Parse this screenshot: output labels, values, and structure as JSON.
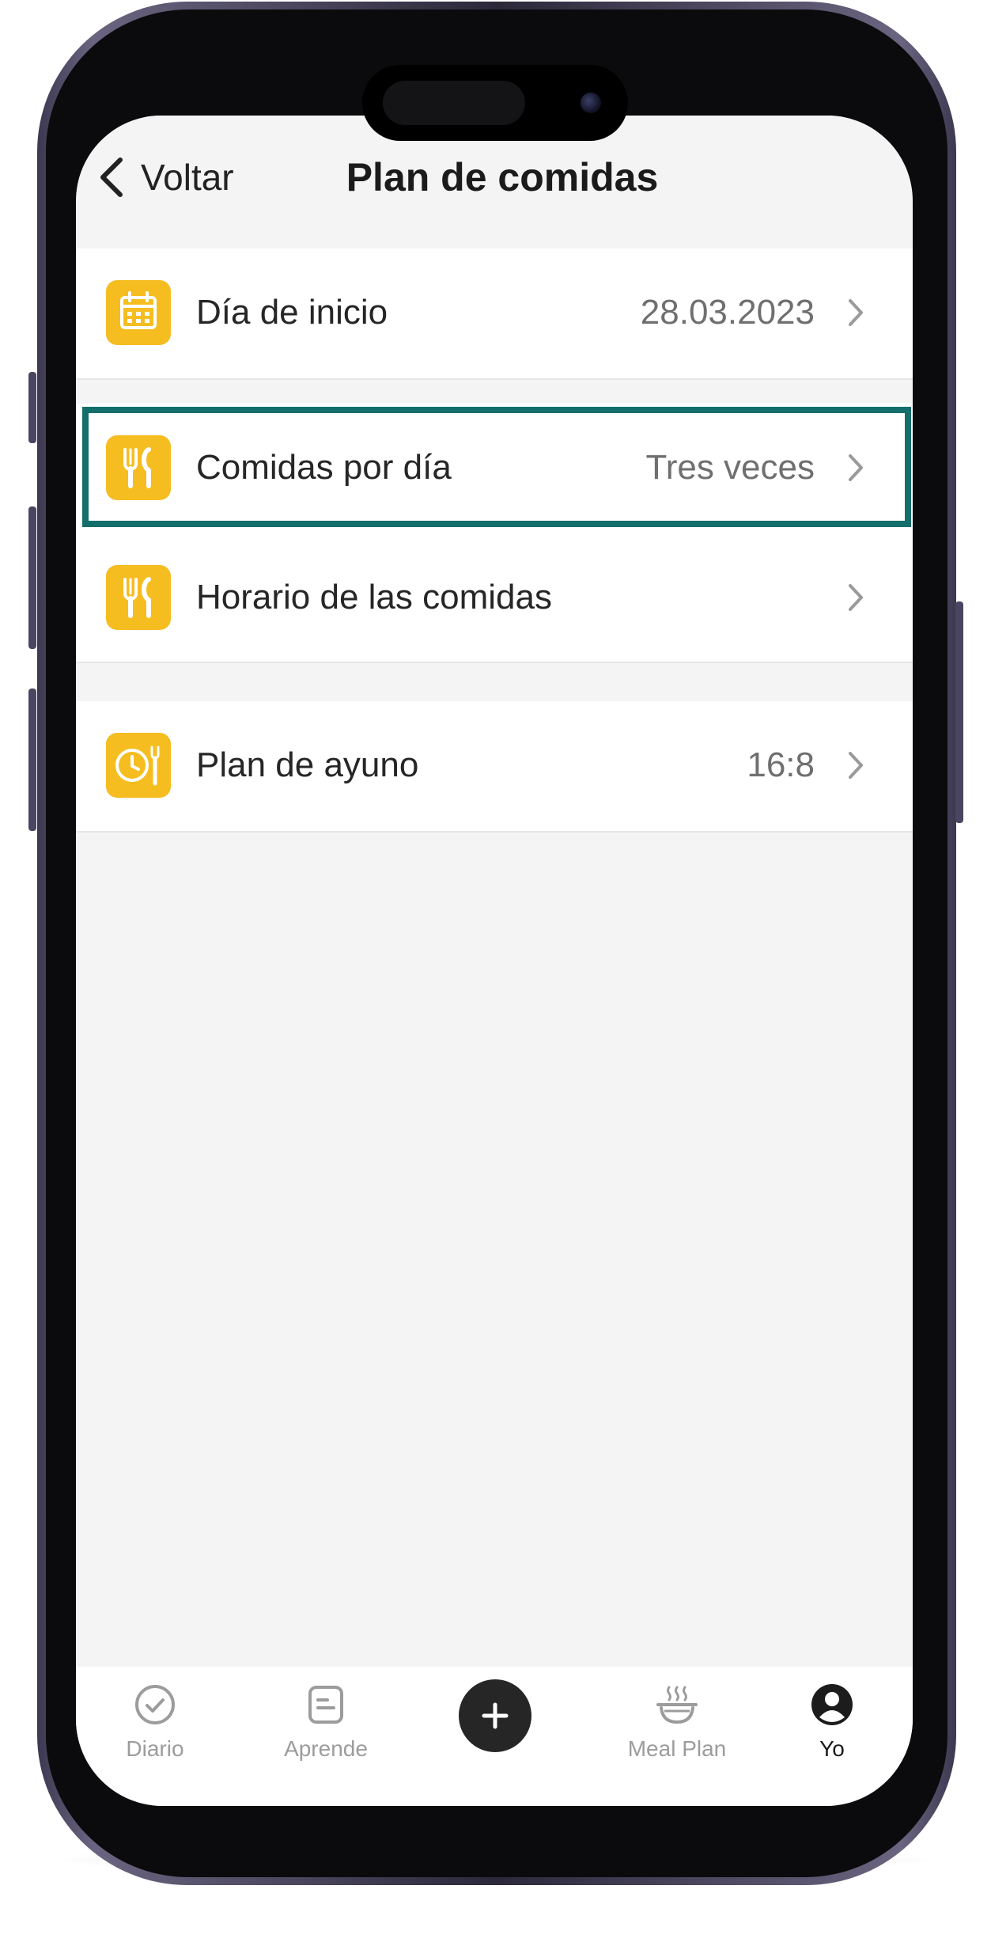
{
  "header": {
    "back_label": "Voltar",
    "title": "Plan de comidas"
  },
  "settings": {
    "start_day": {
      "label": "Día de inicio",
      "value": "28.03.2023",
      "icon": "calendar-icon"
    },
    "meals_per_day": {
      "label": "Comidas por día",
      "value": "Tres veces",
      "icon": "fork-knife-icon",
      "highlighted": true
    },
    "meal_schedule": {
      "label": "Horario de las comidas",
      "value": "",
      "icon": "fork-knife-icon"
    },
    "fasting_plan": {
      "label": "Plan de ayuno",
      "value": "16:8",
      "icon": "clock-fork-icon"
    }
  },
  "tab_bar": {
    "diary": "Diario",
    "learn": "Aprende",
    "add": "+",
    "meal_plan": "Meal Plan",
    "me": "Yo",
    "active": "Yo"
  },
  "colors": {
    "accent_icon": "#f5bd1f",
    "highlight_border": "#146e6c",
    "background": "#f4f4f4"
  }
}
